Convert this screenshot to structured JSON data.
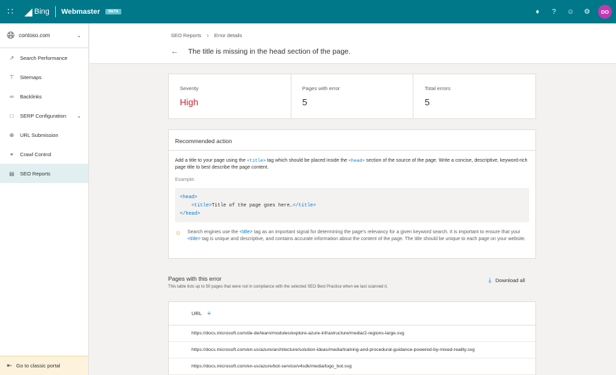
{
  "topbar": {
    "brand": "Bing",
    "product": "Webmaster",
    "beta": "BETA",
    "icons": [
      "bell-icon",
      "help-icon",
      "smiley-icon",
      "gear-icon"
    ],
    "avatar_initials": "DO",
    "color": "#00788a"
  },
  "sidebar": {
    "site": "contoso.com",
    "items": [
      {
        "label": "Search Performance",
        "icon": "trend-icon"
      },
      {
        "label": "Sitemaps",
        "icon": "sitemap-icon"
      },
      {
        "label": "Backlinks",
        "icon": "link-icon"
      },
      {
        "label": "SERP Configuration",
        "icon": "serp-icon"
      },
      {
        "label": "URL Submission",
        "icon": "globe-icon"
      },
      {
        "label": "Crawl Control",
        "icon": "crawl-icon"
      },
      {
        "label": "SEO Reports",
        "icon": "report-icon"
      }
    ],
    "classic_portal": "Go to classic portal"
  },
  "breadcrumb": {
    "root": "SEO Reports",
    "current": "Error details"
  },
  "page_title": "The title is missing in the head section of the page.",
  "stats": [
    {
      "label": "Severity",
      "value": "High"
    },
    {
      "label": "Pages with error",
      "value": "5"
    },
    {
      "label": "Total errors",
      "value": "5"
    }
  ],
  "recommended": {
    "title": "Recommended action",
    "text_a": "Add a title to your page using the",
    "tag_title": "<title>",
    "text_b": "tag which should be placed inside the",
    "tag_head": "<head>",
    "text_c": "section of the source of the page. Write a concise, descriptive, keyword-rich page title to best describe the page content.",
    "example_label": "Example:",
    "code_line1": "<head>",
    "code_line2_open": "<title>",
    "code_line2_text": "Title of the page goes here…",
    "code_line2_close": "</title>",
    "code_line3": "</head>",
    "tip_a": "Search engines use the",
    "tip_tag": "<title>",
    "tip_b": "tag as an important signal for determining the page's relevancy for a given keyword search. It is important to ensure that your",
    "tip_tag2": "<title>",
    "tip_c": "tag is unique and descriptive, and contains accurate information about the content of the page. The title should be unique to each page on your website."
  },
  "pages": {
    "title": "Pages with this error",
    "subtitle": "This table lists up to 50 pages that were not in compliance with the selected SEO Best Practice when we last scanned it.",
    "download": "Download all",
    "column": "URL",
    "rows": [
      "https://docs.microsoft.com/de-de/learn/modules/explore-azure-infrastructure/media/2-regions-large.svg",
      "https://docs.microsoft.com/en-us/azure/architecture/solution-ideas/media/training-and-procedural-guidance-powered-by-mixed-reality.svg",
      "https://docs.microsoft.com/en-us/azure/bot-service/v4sdk/media/logo_bot.svg"
    ]
  }
}
